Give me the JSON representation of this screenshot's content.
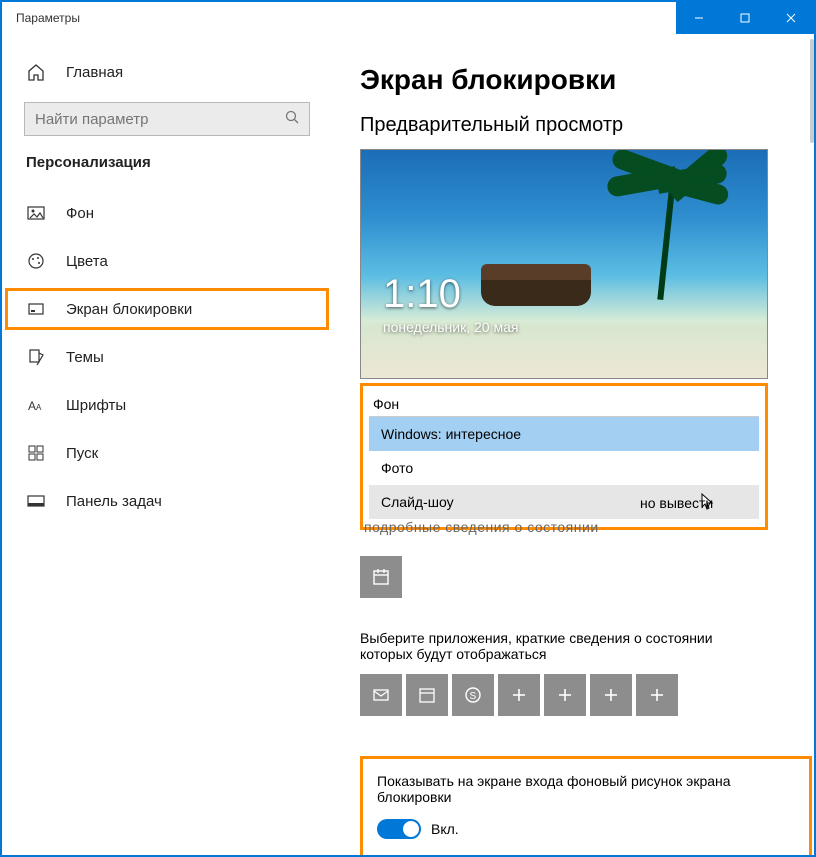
{
  "window": {
    "title": "Параметры"
  },
  "sidebar": {
    "home": "Главная",
    "search_placeholder": "Найти параметр",
    "section": "Персонализация",
    "items": [
      "Фон",
      "Цвета",
      "Экран блокировки",
      "Темы",
      "Шрифты",
      "Пуск",
      "Панель задач"
    ],
    "active_index": 2
  },
  "page": {
    "title": "Экран блокировки",
    "preview_label": "Предварительный просмотр",
    "clock": {
      "time": "1:10",
      "date": "понедельник, 20 мая"
    },
    "background_label": "Фон",
    "dropdown": {
      "options": [
        "Windows: интересное",
        "Фото",
        "Слайд-шоу"
      ],
      "selected_index": 0,
      "hover_index": 2
    },
    "behind_text_right": "но вывести",
    "behind_text_trunc": "подробные сведения о состоянии",
    "detailed_tile_alt": "Календарь",
    "quick_label": "Выберите приложения, краткие сведения о состоянии которых будут отображаться",
    "quick_tiles": [
      "mail",
      "calendar",
      "skype",
      "plus",
      "plus",
      "plus",
      "plus"
    ],
    "toggle_label": "Показывать на экране входа фоновый рисунок экрана блокировки",
    "toggle_state": "Вкл."
  },
  "colors": {
    "accent": "#0078d7",
    "highlight": "#ff8c00"
  }
}
